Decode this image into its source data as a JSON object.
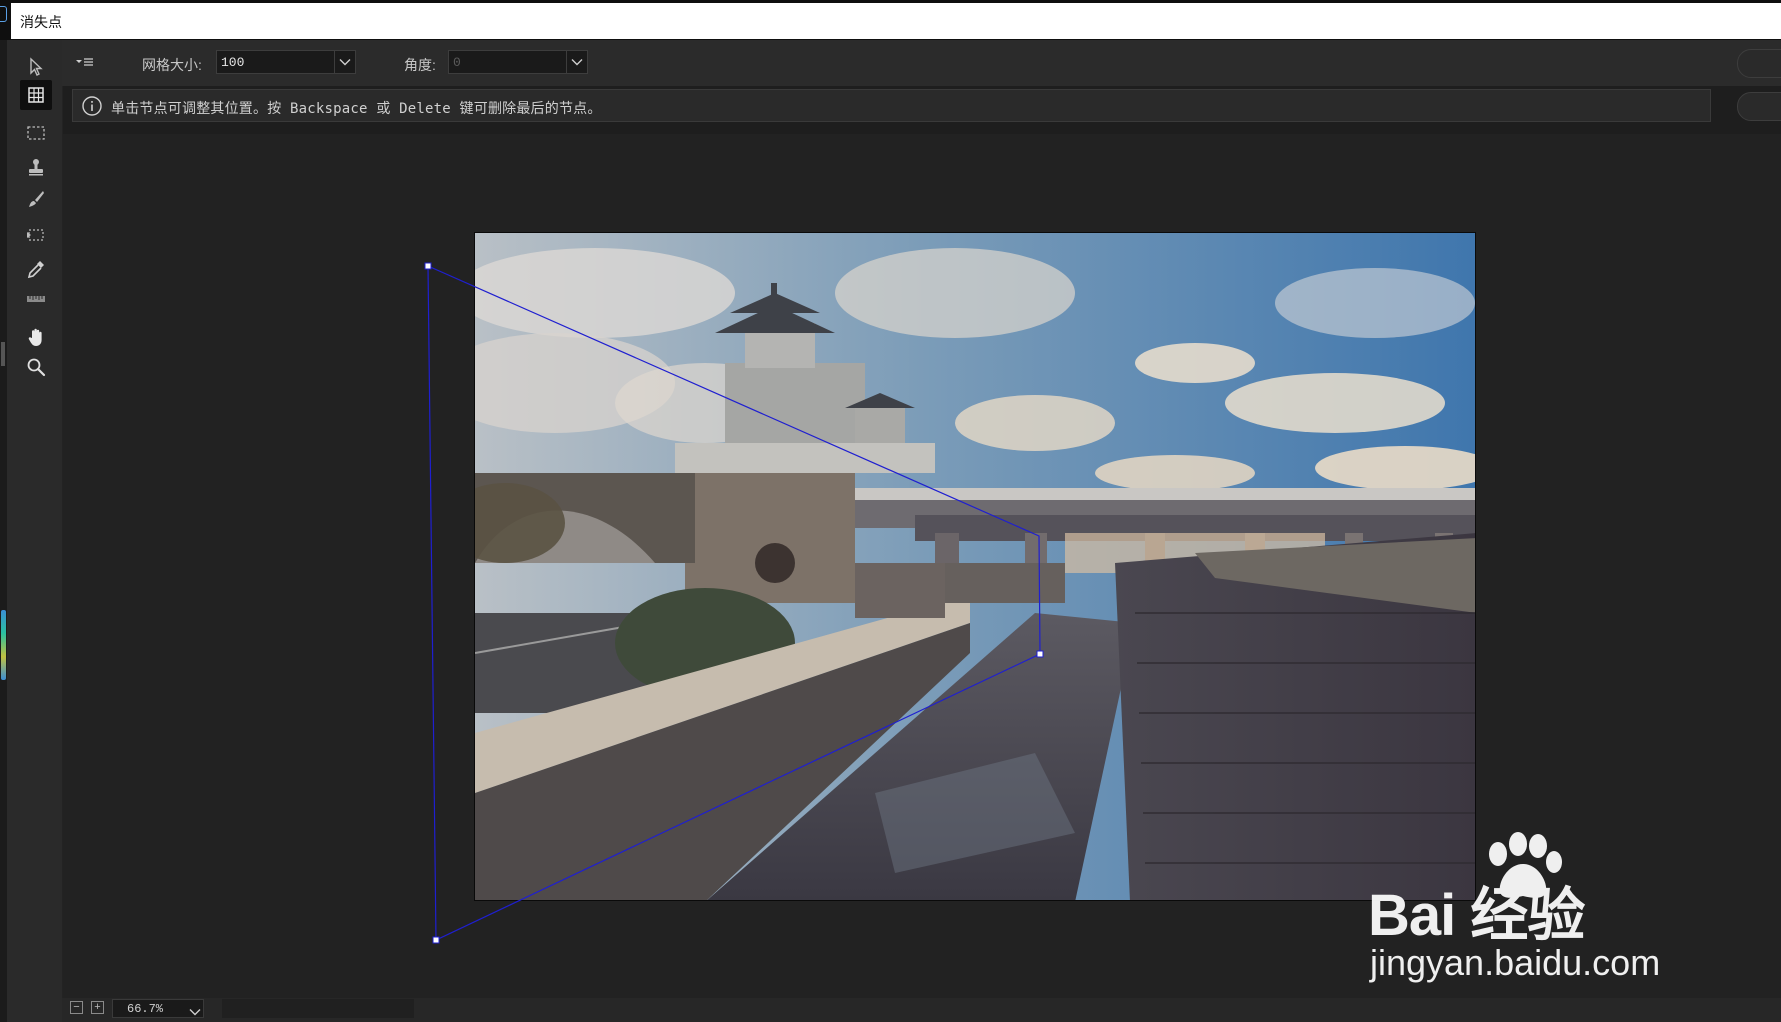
{
  "window": {
    "title": "消失点"
  },
  "tools": [
    {
      "name": "edit-plane-tool",
      "icon": "arrow-cursor-icon"
    },
    {
      "name": "create-plane-tool",
      "icon": "grid-plane-icon",
      "active": true
    },
    {
      "name": "marquee-tool",
      "icon": "marquee-icon"
    },
    {
      "name": "stamp-tool",
      "icon": "stamp-icon"
    },
    {
      "name": "brush-tool",
      "icon": "brush-icon"
    },
    {
      "name": "transform-tool",
      "icon": "transform-icon"
    },
    {
      "name": "eyedropper-tool",
      "icon": "eyedropper-icon"
    },
    {
      "name": "measure-tool",
      "icon": "ruler-icon"
    },
    {
      "name": "hand-tool",
      "icon": "hand-icon"
    },
    {
      "name": "zoom-tool",
      "icon": "magnifier-icon"
    }
  ],
  "options": {
    "menu_icon": "flyout-menu-icon",
    "grid_size_label": "网格大小:",
    "grid_size_value": "100",
    "angle_label": "角度:",
    "angle_value": "0"
  },
  "info": {
    "icon": "info-icon",
    "text": "单击节点可调整其位置。按 Backspace 或 Delete 键可删除最后的节点。"
  },
  "status": {
    "zoom_value": "66.7%",
    "zoom_out_label": "−",
    "zoom_in_label": "+"
  },
  "plane": {
    "color": "#1f1fd0"
  },
  "watermark": {
    "brand": "Bai 经验",
    "url": "jingyan.baidu.com"
  }
}
